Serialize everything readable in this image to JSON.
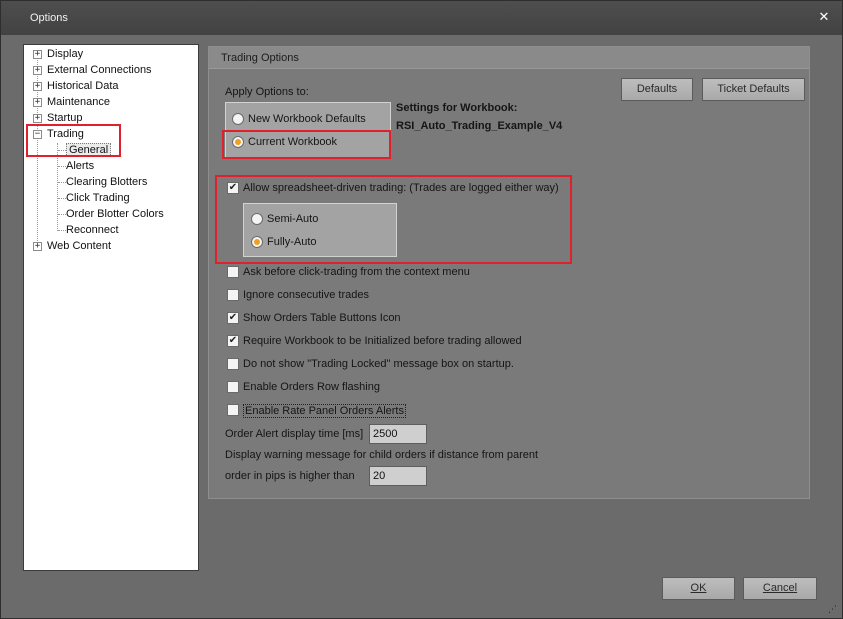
{
  "window": {
    "title": "Options",
    "close_glyph": "✕"
  },
  "tree": {
    "items": [
      {
        "label": "Display",
        "expander": "+"
      },
      {
        "label": "External Connections",
        "expander": "+"
      },
      {
        "label": "Historical Data",
        "expander": "+"
      },
      {
        "label": "Maintenance",
        "expander": "+"
      },
      {
        "label": "Startup",
        "expander": "+"
      },
      {
        "label": "Trading",
        "expander": "−"
      },
      {
        "label": "Web Content",
        "expander": "+"
      }
    ],
    "trading_children": [
      "General",
      "Alerts",
      "Clearing Blotters",
      "Click Trading",
      "Order Blotter Colors",
      "Reconnect"
    ]
  },
  "panel": {
    "header": "Trading Options",
    "apply_options_label": "Apply Options to:",
    "defaults_button": "Defaults",
    "ticket_defaults_button": "Ticket Defaults",
    "apply_options": {
      "new_workbook": "New Workbook Defaults",
      "current_workbook": "Current Workbook"
    },
    "settings_for_label": "Settings for Workbook:",
    "workbook_name": "RSI_Auto_Trading_Example_V4",
    "allow_trading": "Allow spreadsheet-driven trading: (Trades are logged either way)",
    "semi_auto": "Semi-Auto",
    "fully_auto": "Fully-Auto",
    "checkboxes": [
      {
        "label": "Ask before click-trading from the context menu",
        "checked": false
      },
      {
        "label": "Ignore consecutive trades",
        "checked": false
      },
      {
        "label": "Show Orders Table Buttons Icon",
        "checked": true
      },
      {
        "label": "Require Workbook to be Initialized before trading allowed",
        "checked": true
      },
      {
        "label": "Do not show \"Trading Locked\" message box on startup.",
        "checked": false
      },
      {
        "label": "Enable Orders Row flashing",
        "checked": false
      },
      {
        "label": "Enable Rate Panel Orders Alerts",
        "checked": false
      }
    ],
    "alert_time_label": "Order Alert display time [ms]",
    "alert_time_value": "2500",
    "warning_line1": "Display warning message for child orders if distance from parent",
    "warning_line2": "order in pips is higher than",
    "pips_value": "20"
  },
  "footer": {
    "ok": "OK",
    "cancel": "Cancel"
  },
  "check_glyph": "✔",
  "colors": {
    "accent_orange": "#f0a020",
    "highlight_red": "#e0202a"
  }
}
